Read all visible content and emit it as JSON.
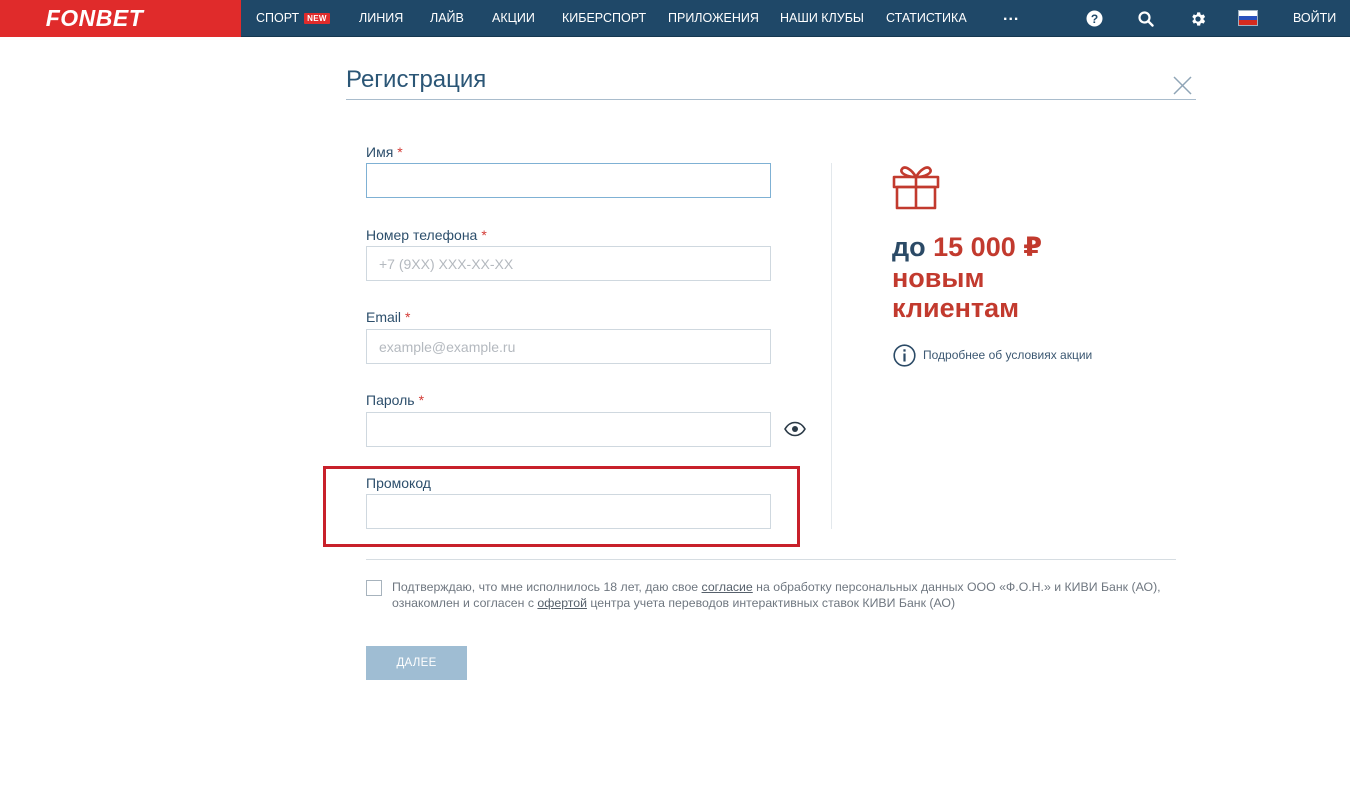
{
  "brand": {
    "logo_text": "FONBET",
    "accent_color": "#e02b2b",
    "nav_bg": "#1f4868"
  },
  "nav": {
    "items": [
      {
        "label": "СПОРТ",
        "badge": "NEW"
      },
      {
        "label": "ЛИНИЯ"
      },
      {
        "label": "ЛАЙВ"
      },
      {
        "label": "АКЦИИ"
      },
      {
        "label": "КИБЕРСПОРТ"
      },
      {
        "label": "ПРИЛОЖЕНИЯ"
      },
      {
        "label": "НАШИ КЛУБЫ"
      },
      {
        "label": "СТАТИСТИКА"
      }
    ],
    "more": "...",
    "icons": [
      "help-icon",
      "search-icon",
      "settings-gear-icon",
      "russia-flag-icon"
    ],
    "login_label": "ВОЙТИ"
  },
  "form": {
    "title": "Регистрация",
    "fields": {
      "name": {
        "label": "Имя",
        "required_mark": "*",
        "value": "",
        "placeholder": ""
      },
      "phone": {
        "label": "Номер телефона",
        "required_mark": "*",
        "value": "",
        "placeholder": "+7 (9XX) XXX-XX-XX"
      },
      "email": {
        "label": "Email",
        "required_mark": "*",
        "value": "",
        "placeholder": "example@example.ru"
      },
      "password": {
        "label": "Пароль",
        "required_mark": "*",
        "value": "",
        "placeholder": ""
      },
      "promo": {
        "label": "Промокод",
        "value": "",
        "placeholder": ""
      }
    },
    "agreement": {
      "checked": false,
      "text_1": "Подтверждаю, что мне исполнилось 18 лет, даю свое ",
      "link_1": "согласие",
      "text_2": " на обработку персональных данных ООО «Ф.О.Н.» и КИВИ Банк (АО), ознакомлен и согласен с ",
      "link_2": "офертой",
      "text_3": " центра учета переводов интерактивных ставок КИВИ Банк (АО)"
    },
    "next_label": "ДАЛЕЕ",
    "highlight_color": "#c8202a"
  },
  "promo": {
    "icon": "gift-icon",
    "line1_prefix": "до ",
    "line1_amount": "15 000 ₽",
    "line2": "новым",
    "line3": "клиентам",
    "details_link": "Подробнее об условиях акции",
    "colors": {
      "dark": "#2b4a66",
      "red": "#c23a2e"
    }
  }
}
